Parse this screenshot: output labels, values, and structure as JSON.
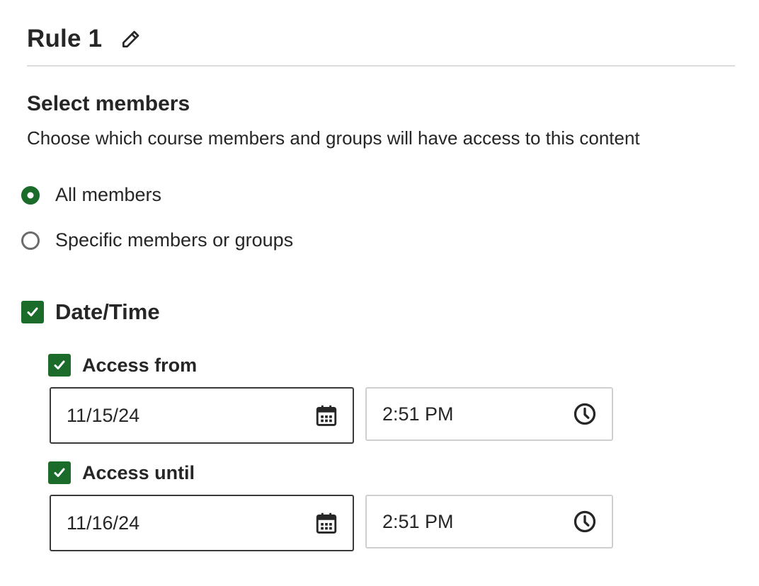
{
  "rule": {
    "title": "Rule 1",
    "edit_icon": "pencil-icon"
  },
  "members": {
    "heading": "Select members",
    "description": "Choose which course members and groups will have access to this content",
    "options": [
      {
        "label": "All members",
        "selected": true
      },
      {
        "label": "Specific members or groups",
        "selected": false
      }
    ]
  },
  "datetime": {
    "label": "Date/Time",
    "checked": true,
    "access_from": {
      "label": "Access from",
      "checked": true,
      "date": "11/15/24",
      "time": "2:51 PM"
    },
    "access_until": {
      "label": "Access until",
      "checked": true,
      "date": "11/16/24",
      "time": "2:51 PM"
    }
  },
  "icons": {
    "date": "calendar-icon",
    "time": "clock-icon",
    "check": "checkmark-icon"
  },
  "colors": {
    "accent": "#1b6b2b",
    "text": "#262626",
    "divider": "#dcdcdc"
  }
}
